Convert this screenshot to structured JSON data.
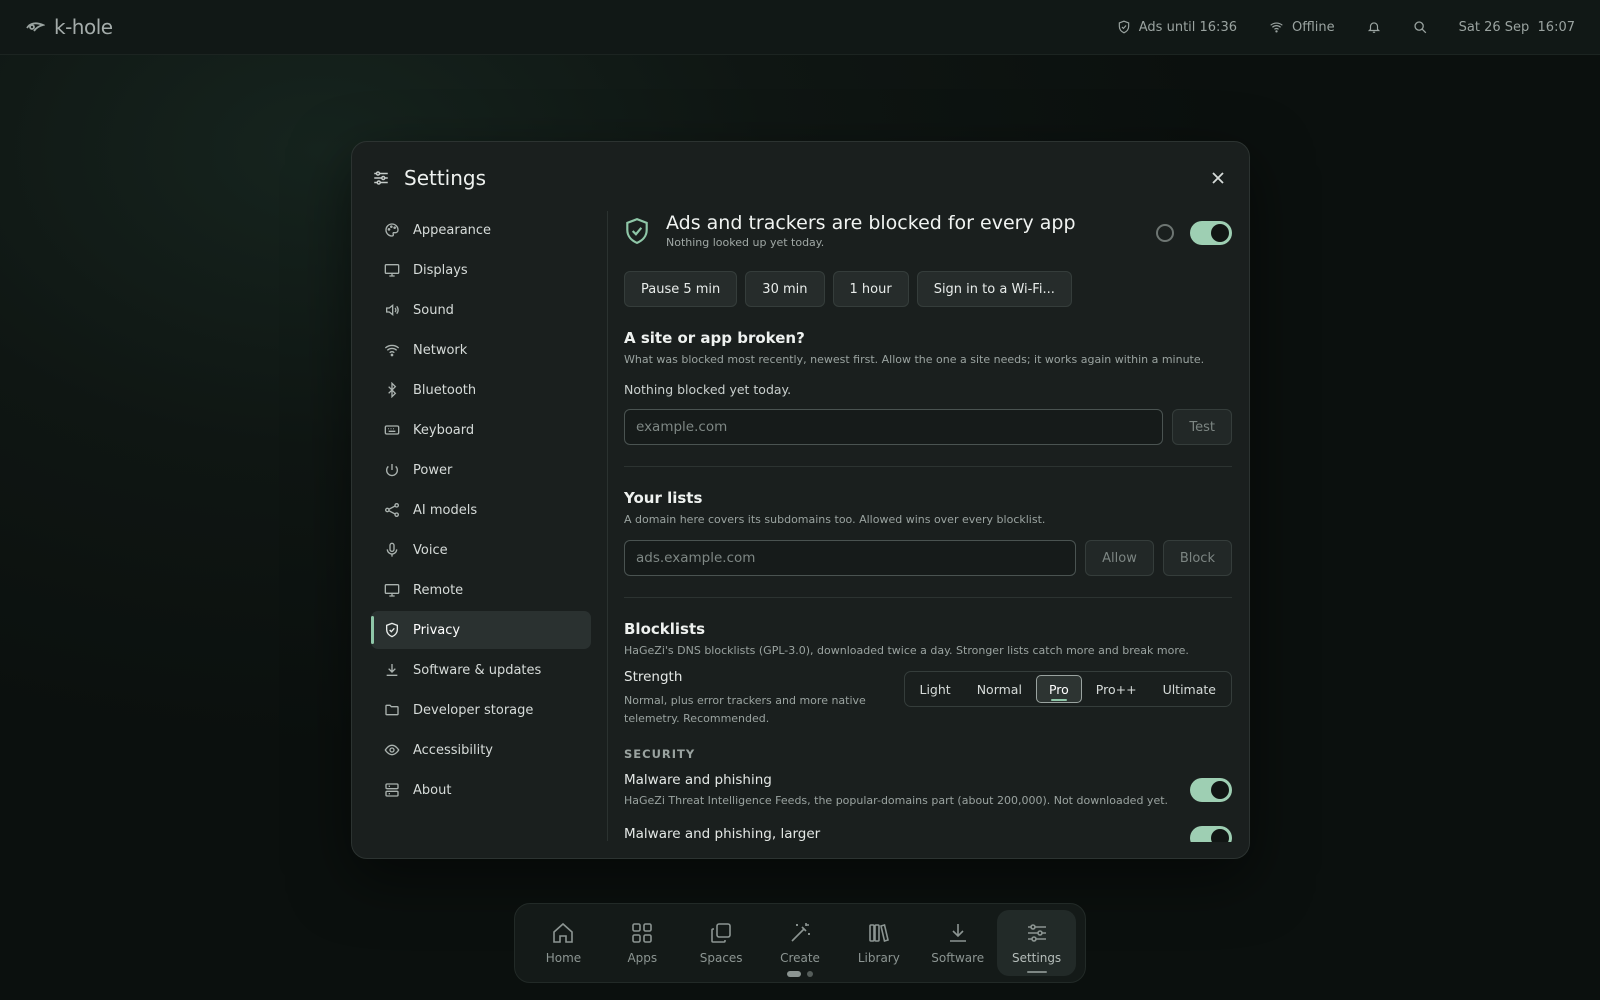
{
  "topbar": {
    "brand": "k-hole",
    "ads_status": "Ads until 16:36",
    "network_status": "Offline",
    "datetime": "Sat 26 Sep  16:07"
  },
  "modal": {
    "title": "Settings"
  },
  "sidebar": {
    "items": [
      {
        "label": "Appearance",
        "icon": "palette-icon"
      },
      {
        "label": "Displays",
        "icon": "monitor-icon"
      },
      {
        "label": "Sound",
        "icon": "speaker-icon"
      },
      {
        "label": "Network",
        "icon": "wifi-icon"
      },
      {
        "label": "Bluetooth",
        "icon": "bluetooth-icon"
      },
      {
        "label": "Keyboard",
        "icon": "keyboard-icon"
      },
      {
        "label": "Power",
        "icon": "power-icon"
      },
      {
        "label": "AI models",
        "icon": "share-nodes-icon"
      },
      {
        "label": "Voice",
        "icon": "microphone-icon"
      },
      {
        "label": "Remote",
        "icon": "monitor-icon"
      },
      {
        "label": "Privacy",
        "icon": "shield-check-icon",
        "active": true
      },
      {
        "label": "Software & updates",
        "icon": "download-icon"
      },
      {
        "label": "Developer storage",
        "icon": "folder-icon"
      },
      {
        "label": "Accessibility",
        "icon": "eye-icon"
      },
      {
        "label": "About",
        "icon": "server-icon"
      }
    ]
  },
  "privacy": {
    "hero_title": "Ads and trackers are blocked for every app",
    "hero_sub": "Nothing looked up yet today.",
    "blocking_enabled": true,
    "pause_buttons": [
      "Pause 5 min",
      "30 min",
      "1 hour",
      "Sign in to a Wi-Fi..."
    ],
    "broken": {
      "title": "A site or app broken?",
      "desc": "What was blocked most recently, newest first. Allow the one a site needs; it works again within a minute.",
      "empty": "Nothing blocked yet today.",
      "placeholder": "example.com",
      "test_label": "Test"
    },
    "lists": {
      "title": "Your lists",
      "desc": "A domain here covers its subdomains too. Allowed wins over every blocklist.",
      "placeholder": "ads.example.com",
      "allow_label": "Allow",
      "block_label": "Block"
    },
    "blocklists": {
      "title": "Blocklists",
      "desc": "HaGeZi's DNS blocklists (GPL-3.0), downloaded twice a day. Stronger lists catch more and break more.",
      "strength_label": "Strength",
      "strength_desc_1": "Normal, plus error trackers and more native",
      "strength_desc_2": "telemetry. Recommended.",
      "options": [
        "Light",
        "Normal",
        "Pro",
        "Pro++",
        "Ultimate"
      ],
      "selected": "Pro"
    },
    "security": {
      "heading": "SECURITY",
      "item1_title": "Malware and phishing",
      "item1_desc": "HaGeZi Threat Intelligence Feeds, the popular-domains part (about 200,000). Not downloaded yet.",
      "item1_enabled": true,
      "item2_title": "Malware and phishing, larger"
    }
  },
  "dock": {
    "items": [
      {
        "label": "Home",
        "icon": "home-icon"
      },
      {
        "label": "Apps",
        "icon": "grid-icon"
      },
      {
        "label": "Spaces",
        "icon": "copy-icon"
      },
      {
        "label": "Create",
        "icon": "magic-wand-icon"
      },
      {
        "label": "Library",
        "icon": "books-icon"
      },
      {
        "label": "Software",
        "icon": "download-icon"
      },
      {
        "label": "Settings",
        "icon": "sliders-icon",
        "active": true
      }
    ]
  },
  "colors": {
    "accent": "#8fc7a8",
    "toggle_on": "#9ecfb3",
    "modal_bg": "#1a1f1e"
  }
}
